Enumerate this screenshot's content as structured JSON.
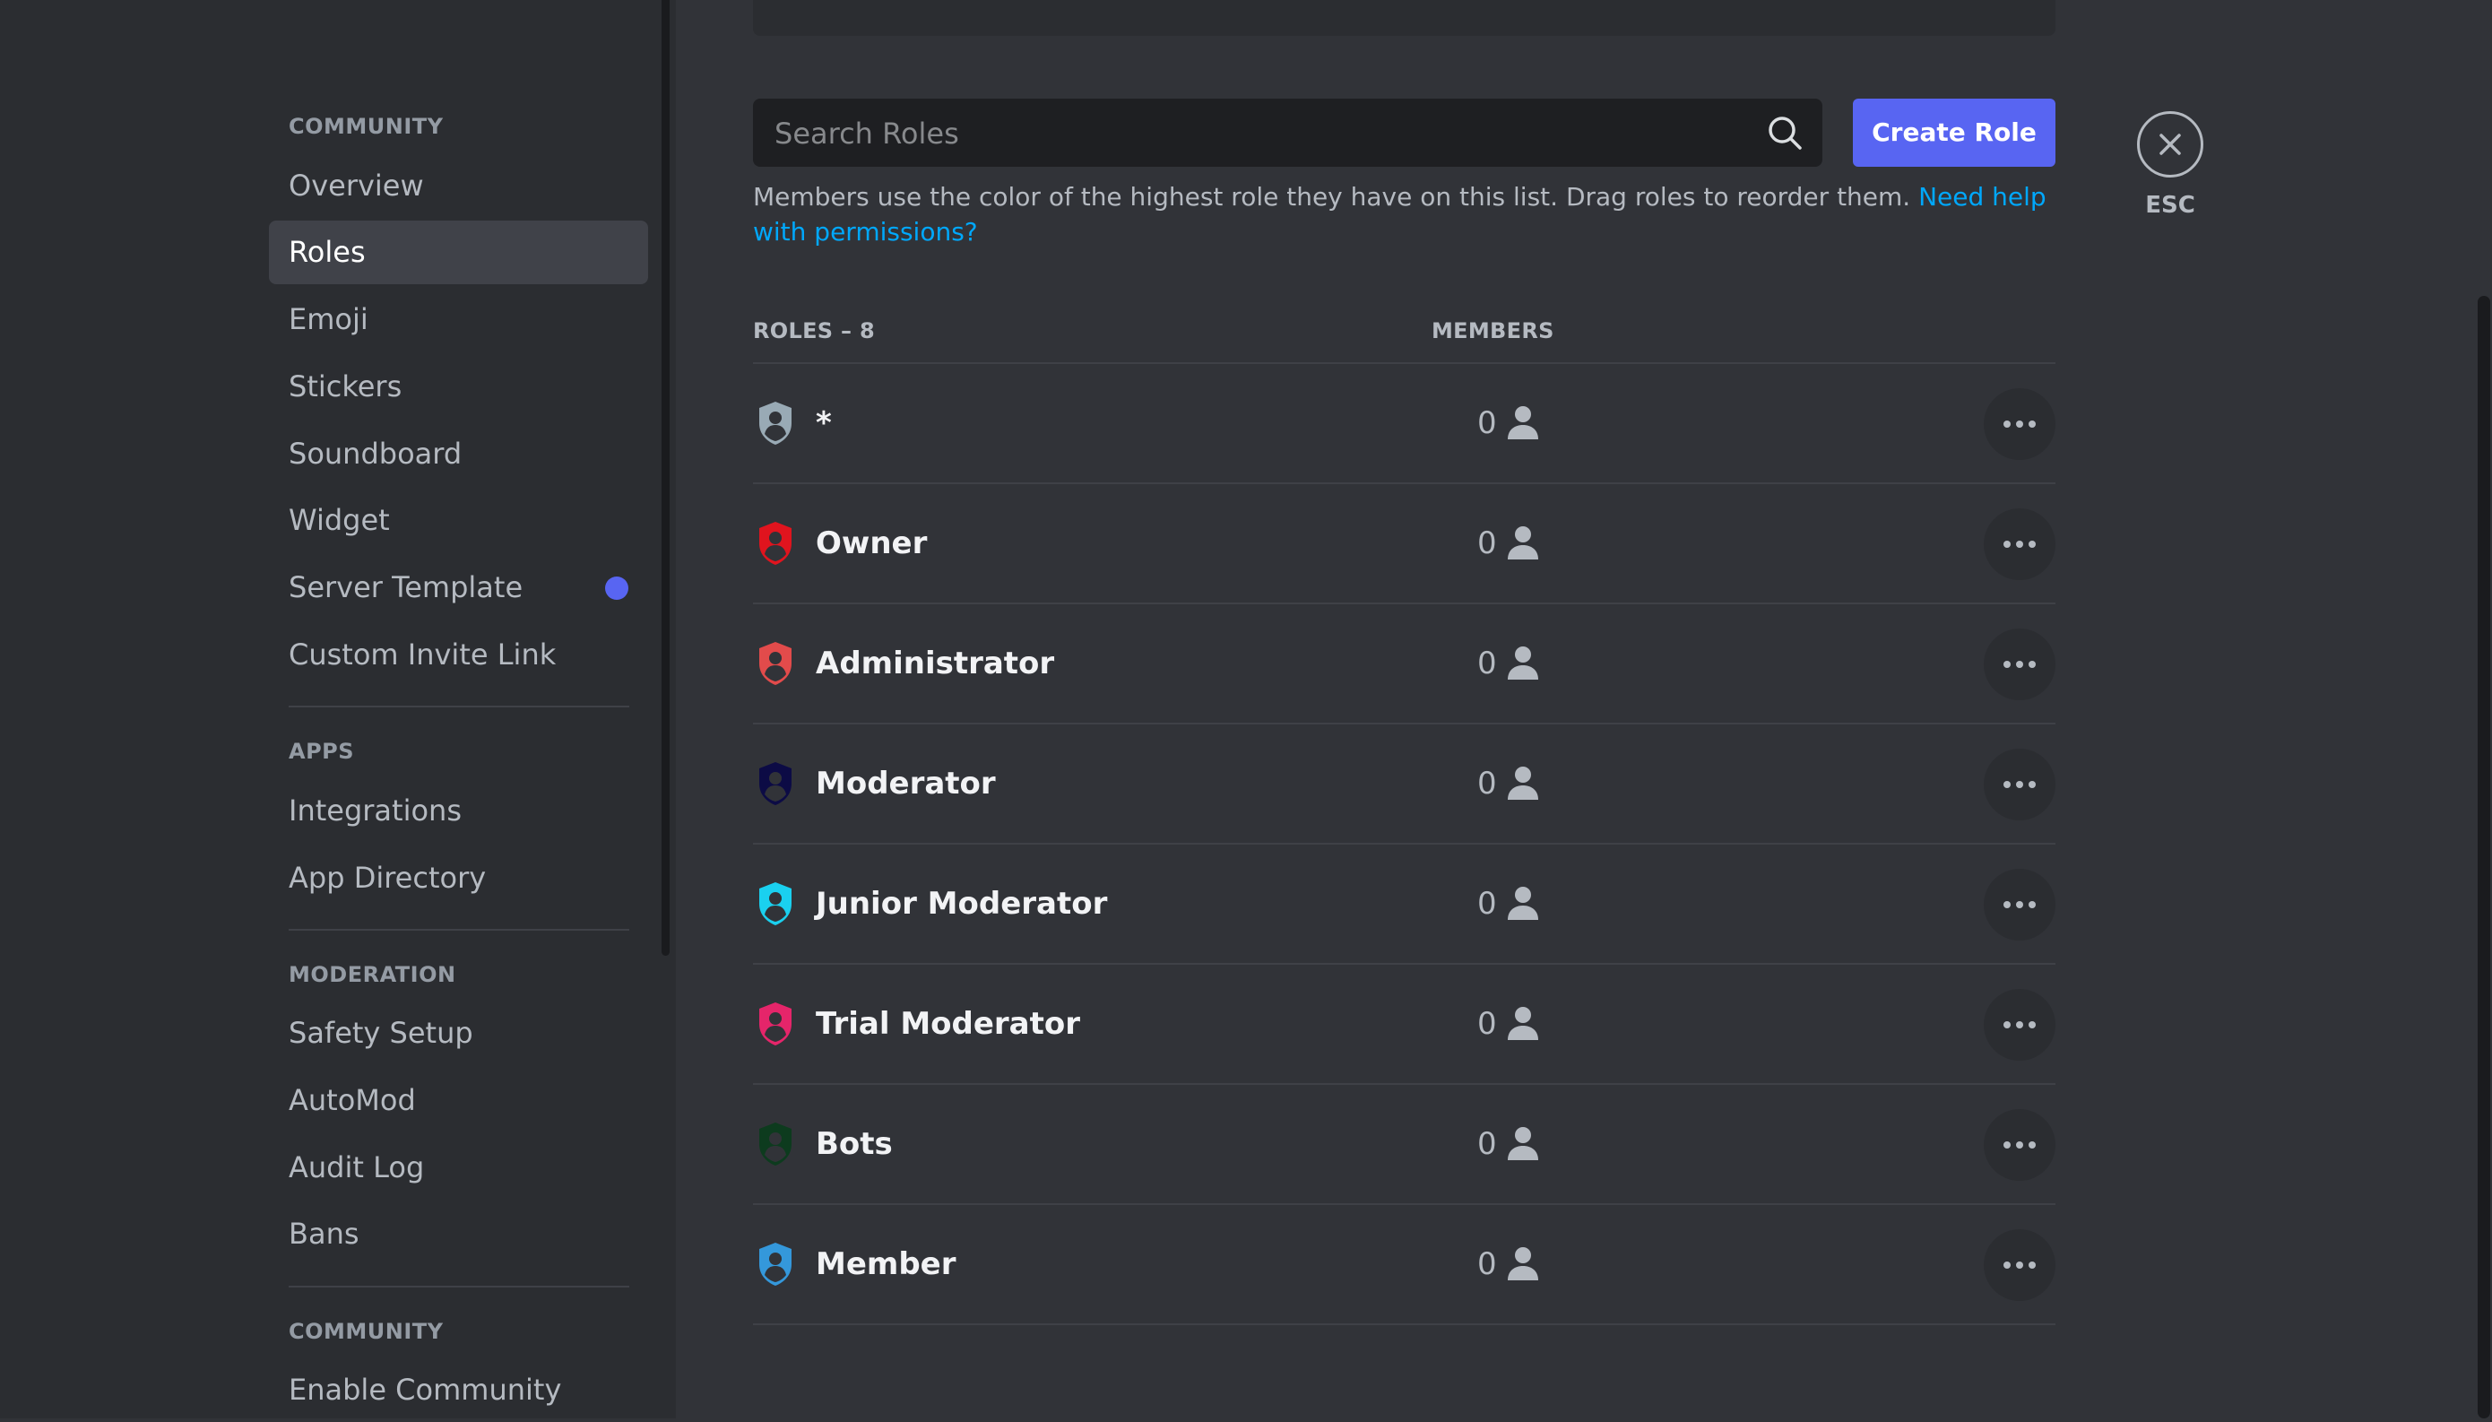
{
  "sidebar": {
    "sections": [
      {
        "header": "Community",
        "items": [
          "Overview",
          "Roles",
          "Emoji",
          "Stickers",
          "Soundboard",
          "Widget",
          "Server Template",
          "Custom Invite Link"
        ]
      },
      {
        "header": "Apps",
        "items": [
          "Integrations",
          "App Directory"
        ]
      },
      {
        "header": "Moderation",
        "items": [
          "Safety Setup",
          "AutoMod",
          "Audit Log",
          "Bans"
        ]
      },
      {
        "header": "Community",
        "items": [
          "Enable Community"
        ]
      }
    ],
    "selected": "Roles",
    "notification_item": "Server Template",
    "notification_color": "#5865f2"
  },
  "search": {
    "placeholder": "Search Roles",
    "value": ""
  },
  "create_role_label": "Create Role",
  "close": {
    "label": "ESC"
  },
  "description": {
    "text": "Members use the color of the highest role they have on this list. Drag roles to reorder them. ",
    "link": "Need help with permissions?"
  },
  "table": {
    "roles_header": "ROLES – 8",
    "members_header": "MEMBERS",
    "roles": [
      {
        "name": "*",
        "members": "0",
        "color": "#99aab5"
      },
      {
        "name": "Owner",
        "members": "0",
        "color": "#e0141e"
      },
      {
        "name": "Administrator",
        "members": "0",
        "color": "#e24b4b"
      },
      {
        "name": "Moderator",
        "members": "0",
        "color": "#0c0b45"
      },
      {
        "name": "Junior Moderator",
        "members": "0",
        "color": "#1ad0ef"
      },
      {
        "name": "Trial Moderator",
        "members": "0",
        "color": "#e5256a"
      },
      {
        "name": "Bots",
        "members": "0",
        "color": "#0d3b1e"
      },
      {
        "name": "Member",
        "members": "0",
        "color": "#3498db"
      }
    ]
  },
  "colors": {
    "accent": "#5865f2",
    "link": "#00a8fc",
    "background": "#313338",
    "sidebar": "#2b2d31"
  }
}
